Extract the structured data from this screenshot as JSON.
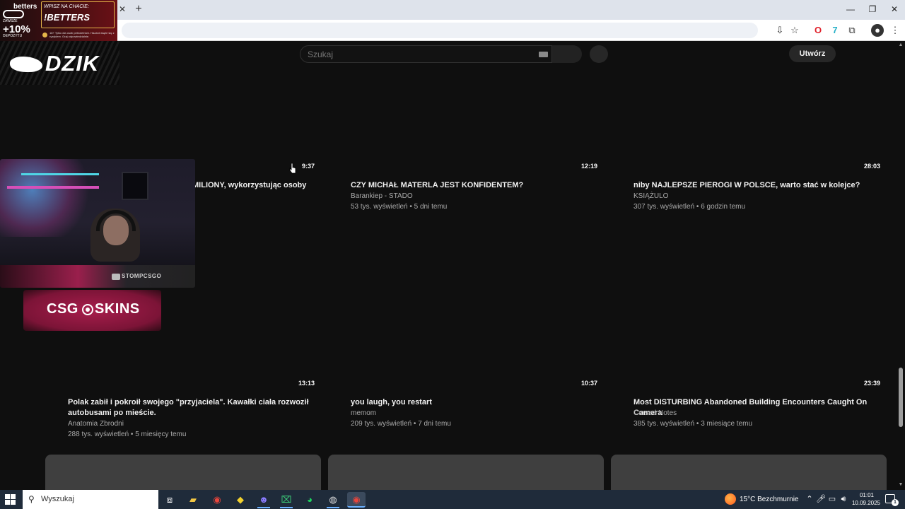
{
  "browser": {
    "new_tab_glyph": "+",
    "close_tab_glyph": "✕",
    "controls": {
      "minimize": "—",
      "restore": "❐",
      "close": "✕"
    }
  },
  "overlays": {
    "ad": {
      "brand": "betters",
      "small": "ZAWSZE",
      "percent": "+10%",
      "deposit": "DEPOZYTU",
      "line1": "WPISZ NA CHACIE:",
      "line2": "!BETTERS",
      "fine_print": "18+ Tylko dla osób pełnoletnich. Hazard wiąże się z ryzykiem. Graj odpowiedzialnie."
    },
    "dzik": {
      "text": "DZIK"
    },
    "webcam": {
      "handle": "STOMPCSGO"
    },
    "csg": {
      "left": "CSG",
      "right": "SKINS"
    }
  },
  "header": {
    "search_placeholder": "Szukaj",
    "create_label": "Utwórz"
  },
  "videos": [
    {
      "duration": "9:37",
      "title": "MILIONY, wykorzystując osoby",
      "channel": "",
      "meta": ""
    },
    {
      "duration": "12:19",
      "title": "CZY MICHAŁ MATERLA JEST KONFIDENTEM?",
      "channel": "Barankiep - STADO",
      "meta": "53 tys. wyświetleń • 5 dni temu"
    },
    {
      "duration": "28:03",
      "title": "niby NAJLEPSZE PIEROGI W POLSCE, warto stać w kolejce?",
      "channel": "KSIĄŻULO",
      "meta": "307 tys. wyświetleń • 6 godzin temu"
    },
    {
      "duration": "13:13",
      "title_line1": "Polak zabił i pokroił swojego \"przyjaciela\". Kawałki ciała rozwoził",
      "title_line2": "autobusami po mieście.",
      "channel": "Anatomia Zbrodni",
      "meta": "288 tys. wyświetleń • 5 miesięcy temu"
    },
    {
      "duration": "10:37",
      "title": "you laugh, you restart",
      "channel": "memom",
      "meta": "209 tys. wyświetleń • 7 dni temu"
    },
    {
      "duration": "23:39",
      "title": "Most DISTURBING Abandoned Building Encounters Caught On Camera",
      "channel": "Cursed Notes",
      "meta": "385 tys. wyświetleń • 3 miesiące temu"
    }
  ],
  "taskbar": {
    "search_placeholder": "Wyszukaj",
    "weather": "15°C  Bezchmurnie",
    "time": "01:01",
    "date": "10.09.2025",
    "notifications": "1"
  }
}
